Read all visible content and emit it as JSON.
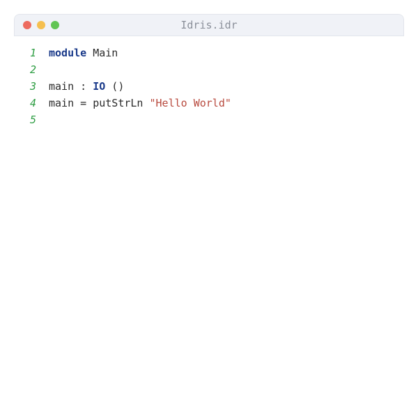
{
  "window": {
    "title": "Idris.idr"
  },
  "code": {
    "lines": [
      {
        "num": "1",
        "tokens": [
          {
            "t": "module",
            "c": "keyword"
          },
          {
            "t": " Main",
            "c": "plain"
          }
        ]
      },
      {
        "num": "2",
        "tokens": []
      },
      {
        "num": "3",
        "tokens": [
          {
            "t": "main : ",
            "c": "plain"
          },
          {
            "t": "IO",
            "c": "type"
          },
          {
            "t": " ()",
            "c": "plain"
          }
        ]
      },
      {
        "num": "4",
        "tokens": [
          {
            "t": "main = putStrLn ",
            "c": "plain"
          },
          {
            "t": "\"Hello World\"",
            "c": "string"
          }
        ]
      },
      {
        "num": "5",
        "tokens": []
      }
    ]
  }
}
